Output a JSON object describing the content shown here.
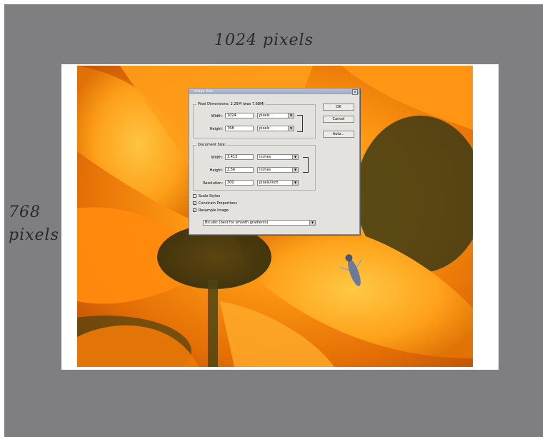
{
  "captions": {
    "width": "1024 pixels",
    "height_line1": "768",
    "height_line2": "pixels"
  },
  "dialog": {
    "title": "Image Size",
    "close_glyph": "x",
    "pixel_dimensions": {
      "label": "Pixel Dimensions:  2.25M (was 7.68M)",
      "width_label": "Width:",
      "width_value": "1024",
      "width_unit": "pixels",
      "height_label": "Height:",
      "height_value": "768",
      "height_unit": "pixels"
    },
    "document_size": {
      "label": "Document Size:",
      "width_label": "Width:",
      "width_value": "3.413",
      "width_unit": "inches",
      "height_label": "Height:",
      "height_value": "2.56",
      "height_unit": "inches",
      "resolution_label": "Resolution:",
      "resolution_value": "300",
      "resolution_unit": "pixels/inch"
    },
    "options": {
      "scale_styles": "Scale Styles",
      "constrain_proportions": "Constrain Proportions",
      "resample_image": "Resample Image:",
      "resample_method": "Bicubic (best for smooth gradients)"
    },
    "buttons": {
      "ok": "OK",
      "cancel": "Cancel",
      "auto": "Auto..."
    }
  },
  "colors": {
    "background": "#7f7e80",
    "paper": "#ffffff",
    "photo_primary": "#ff9a12",
    "dialog_bg": "#e4e2de"
  }
}
